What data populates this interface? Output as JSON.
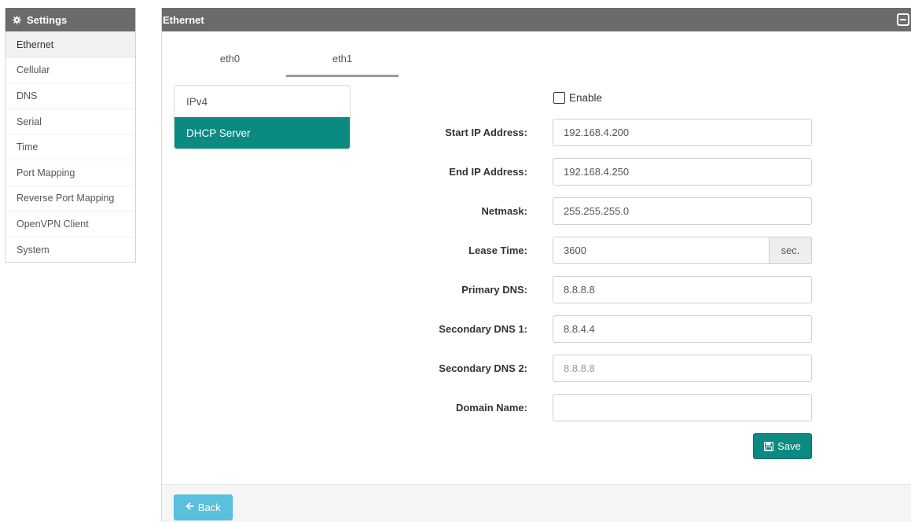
{
  "sidebar": {
    "title": "Settings",
    "icon": "gear-icon",
    "items": [
      {
        "label": "Ethernet",
        "active": true
      },
      {
        "label": "Cellular"
      },
      {
        "label": "DNS"
      },
      {
        "label": "Serial"
      },
      {
        "label": "Time"
      },
      {
        "label": "Port Mapping"
      },
      {
        "label": "Reverse Port Mapping"
      },
      {
        "label": "OpenVPN Client"
      },
      {
        "label": "System"
      }
    ]
  },
  "panel": {
    "title": "Ethernet",
    "collapse_icon": "collapse-icon",
    "tabs": [
      {
        "label": "eth0"
      },
      {
        "label": "eth1",
        "active": true
      }
    ],
    "pills": [
      {
        "label": "IPv4"
      },
      {
        "label": "DHCP Server",
        "active": true
      }
    ]
  },
  "form": {
    "enable_label": "Enable",
    "enable_checked": false,
    "fields": [
      {
        "label": "Start IP Address:",
        "value": "192.168.4.200",
        "placeholder": ""
      },
      {
        "label": "End IP Address:",
        "value": "192.168.4.250",
        "placeholder": ""
      },
      {
        "label": "Netmask:",
        "value": "255.255.255.0",
        "placeholder": ""
      },
      {
        "label": "Lease Time:",
        "value": "3600",
        "placeholder": "",
        "addon": "sec."
      },
      {
        "label": "Primary DNS:",
        "value": "8.8.8.8",
        "placeholder": ""
      },
      {
        "label": "Secondary DNS 1:",
        "value": "8.8.4.4",
        "placeholder": ""
      },
      {
        "label": "Secondary DNS 2:",
        "value": "",
        "placeholder": "8.8.8.8"
      },
      {
        "label": "Domain Name:",
        "value": "",
        "placeholder": ""
      }
    ],
    "save_label": "Save",
    "save_icon": "floppy-disk-icon"
  },
  "footer": {
    "back_label": "Back",
    "back_icon": "arrow-left-icon"
  },
  "colors": {
    "header_bg": "#6b6b6b",
    "accent": "#0b8a82",
    "back_button": "#5bc0de"
  }
}
